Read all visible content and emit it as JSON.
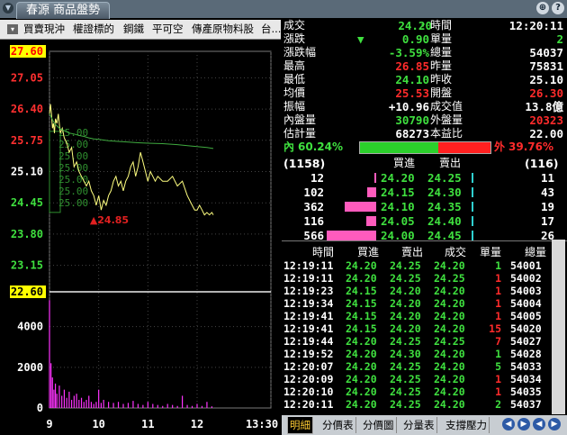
{
  "window": {
    "title": "春源 商品盤勢",
    "btn_search": "⊕",
    "btn_help": "?"
  },
  "toolbar": {
    "checkbox": "▾",
    "items": [
      "買賣現沖",
      "權證標的",
      "鋼鐵",
      "平可空",
      "傳產原物料股",
      "台..."
    ]
  },
  "quote": {
    "rows": [
      {
        "l1": "成交",
        "v1": "24.20",
        "c1": "green",
        "suffix1": "▾",
        "l2": "時間",
        "v2": "12:20:11",
        "c2": "white"
      },
      {
        "l1": "漲跌",
        "v1": "0.90",
        "c1": "green",
        "prefix1": "▼",
        "l2": "單量",
        "v2": "2",
        "c2": "green"
      },
      {
        "l1": "漲跌幅",
        "v1": "-3.59%",
        "c1": "green",
        "l2": "總量",
        "v2": "54037",
        "c2": "white"
      },
      {
        "l1": "最高",
        "v1": "26.85",
        "c1": "red",
        "l2": "昨量",
        "v2": "75831",
        "c2": "white"
      },
      {
        "l1": "最低",
        "v1": "24.10",
        "c1": "green",
        "l2": "昨收",
        "v2": "25.10",
        "c2": "white"
      },
      {
        "l1": "均價",
        "v1": "25.53",
        "c1": "red",
        "l2": "開盤",
        "v2": "26.30",
        "c2": "red"
      },
      {
        "l1": "振幅",
        "v1": "+10.96",
        "c1": "white",
        "l2": "成交值",
        "v2": "13.8億",
        "c2": "white"
      },
      {
        "l1": "內盤量",
        "v1": "30790",
        "c1": "green",
        "l2": "外盤量",
        "v2": "20323",
        "c2": "red"
      },
      {
        "l1": "估計量",
        "v1": "68273",
        "c1": "white",
        "l2": "本益比",
        "v2": "22.00",
        "c2": "white"
      }
    ],
    "inner_label": "內",
    "inner_pct": "60.24%",
    "inner_ratio": 0.6024,
    "outer_label": "外",
    "outer_pct": "39.76%"
  },
  "orderbook": {
    "bid_total": "(1158)",
    "ask_total": "(116)",
    "head_bid": "買進",
    "head_ask": "賣出",
    "rows": [
      {
        "bid_vol": "12",
        "bid": "24.20",
        "ask": "24.25",
        "ask_vol": "11",
        "bid_bar": 0.02,
        "ask_bar": 0.02
      },
      {
        "bid_vol": "102",
        "bid": "24.15",
        "ask": "24.30",
        "ask_vol": "43",
        "bid_bar": 0.18,
        "ask_bar": 0.02
      },
      {
        "bid_vol": "362",
        "bid": "24.10",
        "ask": "24.35",
        "ask_vol": "19",
        "bid_bar": 0.64,
        "ask_bar": 0.02
      },
      {
        "bid_vol": "116",
        "bid": "24.05",
        "ask": "24.40",
        "ask_vol": "17",
        "bid_bar": 0.2,
        "ask_bar": 0.02
      },
      {
        "bid_vol": "566",
        "bid": "24.00",
        "ask": "24.45",
        "ask_vol": "26",
        "bid_bar": 1.0,
        "ask_bar": 0.02
      }
    ]
  },
  "ticks": {
    "headers": [
      "時間",
      "買進",
      "賣出",
      "成交",
      "單量",
      "總量"
    ],
    "rows": [
      {
        "time": "12:19:11",
        "bid": "24.20",
        "ask": "24.25",
        "price": "24.20",
        "vol": "1",
        "vc": "green",
        "total": "54001"
      },
      {
        "time": "12:19:11",
        "bid": "24.20",
        "ask": "24.25",
        "price": "24.25",
        "vol": "1",
        "vc": "red",
        "total": "54002"
      },
      {
        "time": "12:19:23",
        "bid": "24.15",
        "ask": "24.20",
        "price": "24.20",
        "vol": "1",
        "vc": "red",
        "total": "54003"
      },
      {
        "time": "12:19:34",
        "bid": "24.15",
        "ask": "24.20",
        "price": "24.20",
        "vol": "1",
        "vc": "red",
        "total": "54004"
      },
      {
        "time": "12:19:41",
        "bid": "24.15",
        "ask": "24.20",
        "price": "24.20",
        "vol": "1",
        "vc": "red",
        "total": "54005"
      },
      {
        "time": "12:19:41",
        "bid": "24.15",
        "ask": "24.20",
        "price": "24.20",
        "vol": "15",
        "vc": "red",
        "total": "54020"
      },
      {
        "time": "12:19:44",
        "bid": "24.20",
        "ask": "24.25",
        "price": "24.25",
        "vol": "7",
        "vc": "red",
        "total": "54027"
      },
      {
        "time": "12:19:52",
        "bid": "24.20",
        "ask": "24.30",
        "price": "24.20",
        "vol": "1",
        "vc": "green",
        "total": "54028"
      },
      {
        "time": "12:20:07",
        "bid": "24.20",
        "ask": "24.25",
        "price": "24.20",
        "vol": "5",
        "vc": "green",
        "total": "54033"
      },
      {
        "time": "12:20:09",
        "bid": "24.20",
        "ask": "24.25",
        "price": "24.20",
        "vol": "1",
        "vc": "red",
        "total": "54034"
      },
      {
        "time": "12:20:10",
        "bid": "24.20",
        "ask": "24.25",
        "price": "24.20",
        "vol": "1",
        "vc": "red",
        "total": "54035"
      },
      {
        "time": "12:20:11",
        "bid": "24.20",
        "ask": "24.25",
        "price": "24.20",
        "vol": "2",
        "vc": "green",
        "total": "54037"
      }
    ]
  },
  "tabs": [
    "明細",
    "分價表",
    "分價圖",
    "分量表",
    "支撐壓力"
  ],
  "tab_nav": [
    "◀",
    "▶",
    "◀",
    "▶"
  ],
  "chart_data": {
    "type": "line",
    "price_axis": {
      "labels": [
        "27.60",
        "27.05",
        "26.40",
        "25.75",
        "25.10",
        "24.45",
        "23.80",
        "23.15",
        "22.60"
      ],
      "values": [
        27.6,
        27.05,
        26.4,
        25.75,
        25.1,
        24.45,
        23.8,
        23.15,
        22.6
      ],
      "ylim": [
        22.6,
        27.6
      ],
      "top_label_highlight": "27.60",
      "bottom_label_highlight": "22.60"
    },
    "volume_axis": {
      "labels": [
        "4000",
        "2000",
        "0"
      ],
      "values": [
        4000,
        2000,
        0
      ],
      "ylim": [
        0,
        5400
      ]
    },
    "x_ticks": [
      "9",
      "10",
      "11",
      "12",
      "13:30"
    ],
    "x_tick_values": [
      9,
      10,
      11,
      12,
      13.5
    ],
    "xlim": [
      9,
      13.5
    ],
    "low_annotation": "▲24.85",
    "low_annotation_value": 24.1,
    "low_annotation_x": 9.82,
    "volume_profile": [
      {
        "price": 25.0,
        "label": "25.00"
      },
      {
        "price": 25.0,
        "label": "25.00"
      },
      {
        "price": 25.0,
        "label": "25.00"
      },
      {
        "price": 25.0,
        "label": "25.00"
      },
      {
        "price": 25.0,
        "label": "25.00"
      },
      {
        "price": 25.0,
        "label": "25.00"
      },
      {
        "price": 25.0,
        "label": "25.00"
      }
    ],
    "series": [
      {
        "color": "#ffffff",
        "x": [
          9,
          9.02,
          9.04,
          9.06,
          9.08,
          9.1,
          9.12,
          9.15,
          9.18,
          9.22,
          9.26,
          9.3,
          9.35,
          9.4,
          9.45,
          9.5,
          9.55,
          9.6,
          9.65,
          9.7,
          9.75,
          9.8,
          9.85,
          9.9,
          9.95,
          10.0,
          10.05,
          10.1,
          10.15,
          10.2,
          10.25,
          10.3,
          10.35,
          10.4,
          10.45,
          10.5,
          10.55,
          10.6,
          10.65,
          10.7,
          10.75,
          10.8,
          10.85,
          10.9,
          10.95,
          11.0,
          11.05,
          11.1,
          11.15,
          11.2,
          11.3,
          11.4,
          11.5,
          11.6,
          11.7,
          11.8,
          11.9,
          11.95,
          12.0,
          12.05,
          12.1,
          12.15,
          12.2,
          12.25,
          12.3,
          12.33
        ],
        "y": [
          26.3,
          26.5,
          26.3,
          26.0,
          26.1,
          25.9,
          26.2,
          26.1,
          26.3,
          25.9,
          26.0,
          25.8,
          25.7,
          25.5,
          25.6,
          25.2,
          25.3,
          25.1,
          25.0,
          24.9,
          24.8,
          24.9,
          24.7,
          24.6,
          24.4,
          24.6,
          24.3,
          24.5,
          24.4,
          24.6,
          24.7,
          24.9,
          25.0,
          24.8,
          24.9,
          24.7,
          24.9,
          25.0,
          25.2,
          25.3,
          25.0,
          25.2,
          25.5,
          25.3,
          25.1,
          24.9,
          25.1,
          25.0,
          24.9,
          25.0,
          24.9,
          24.9,
          25.0,
          24.8,
          24.9,
          24.6,
          24.4,
          24.3,
          24.3,
          24.4,
          24.3,
          24.2,
          24.25,
          24.2,
          24.25,
          24.2
        ]
      },
      {
        "color": "#3faa3f",
        "x": [
          9,
          9.1,
          9.2,
          9.3,
          9.4,
          9.5,
          9.6,
          9.7,
          9.8,
          9.9,
          10.0,
          10.2,
          10.5,
          10.8,
          11.0,
          11.3,
          11.6,
          11.9,
          12.2,
          12.33
        ],
        "y": [
          26.3,
          26.1,
          26.0,
          25.95,
          25.9,
          25.88,
          25.85,
          25.83,
          25.8,
          25.78,
          25.77,
          25.74,
          25.72,
          25.7,
          25.69,
          25.68,
          25.66,
          25.63,
          25.6,
          25.58
        ]
      }
    ],
    "volume": {
      "color": "#ff33ff",
      "x": [
        9.0,
        9.03,
        9.06,
        9.09,
        9.12,
        9.15,
        9.2,
        9.25,
        9.3,
        9.35,
        9.4,
        9.45,
        9.5,
        9.55,
        9.6,
        9.65,
        9.7,
        9.75,
        9.8,
        9.85,
        9.9,
        9.95,
        10.0,
        10.05,
        10.1,
        10.2,
        10.3,
        10.4,
        10.5,
        10.6,
        10.7,
        10.8,
        10.9,
        11.0,
        11.1,
        11.2,
        11.3,
        11.4,
        11.5,
        11.6,
        11.7,
        11.8,
        11.9,
        12.0,
        12.1,
        12.2,
        12.3
      ],
      "values": [
        5300,
        2200,
        1500,
        900,
        1200,
        700,
        1100,
        600,
        900,
        500,
        800,
        400,
        600,
        700,
        400,
        500,
        300,
        400,
        600,
        300,
        200,
        300,
        900,
        250,
        400,
        300,
        250,
        300,
        200,
        250,
        350,
        200,
        150,
        300,
        200,
        150,
        100,
        200,
        150,
        100,
        600,
        150,
        100,
        200,
        100,
        300,
        80
      ]
    }
  }
}
